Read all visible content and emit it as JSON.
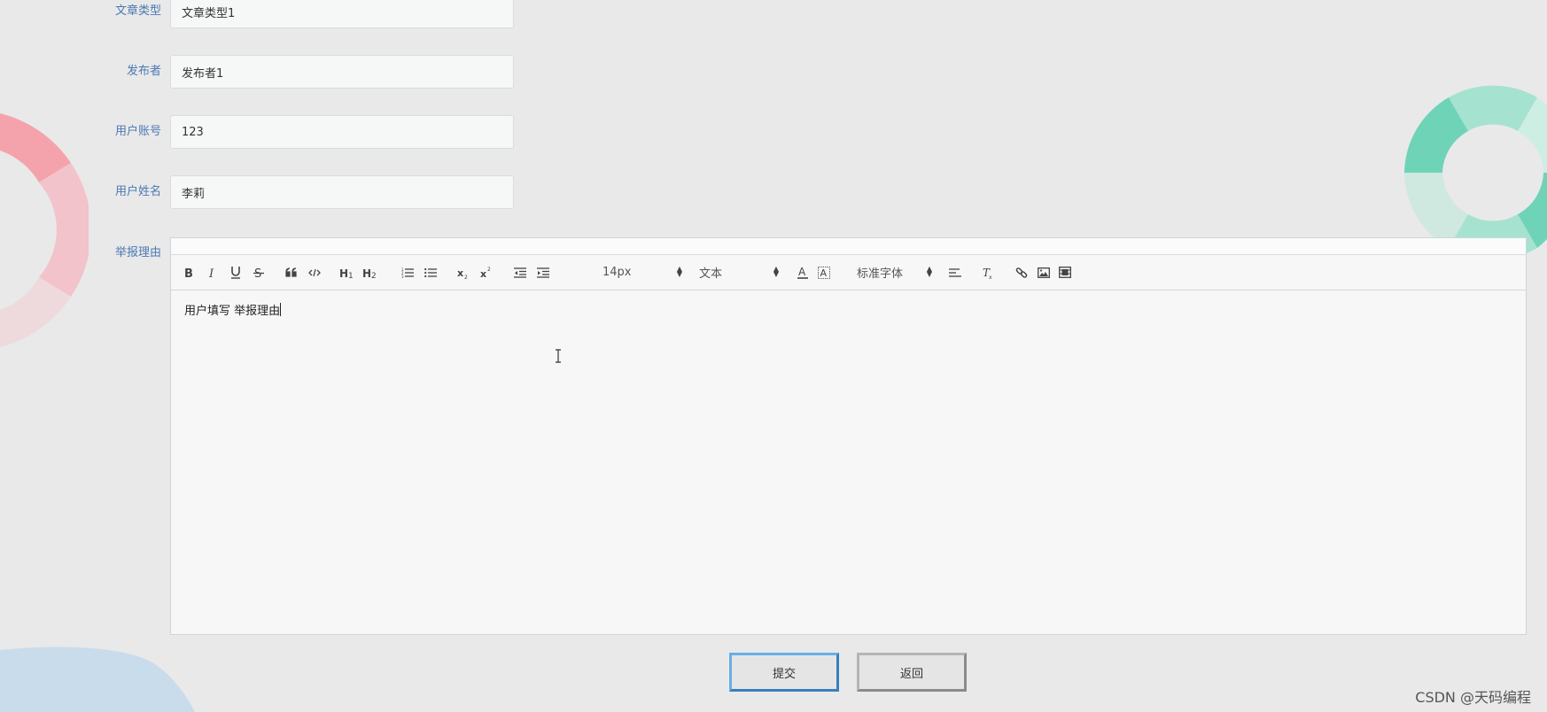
{
  "form": {
    "fields": [
      {
        "label": "文章类型",
        "value": "文章类型1"
      },
      {
        "label": "发布者",
        "value": "发布者1"
      },
      {
        "label": "用户账号",
        "value": "123"
      },
      {
        "label": "用户姓名",
        "value": "李莉"
      }
    ],
    "reason_label": "举报理由"
  },
  "editor": {
    "toolbar": {
      "font_size": "14px",
      "heading": "文本",
      "font_family": "标准字体",
      "icons": [
        "bold-icon",
        "italic-icon",
        "underline-icon",
        "strike-icon",
        "quote-icon",
        "code-icon",
        "h1-icon",
        "h2-icon",
        "ordered-list-icon",
        "bullet-list-icon",
        "subscript-icon",
        "superscript-icon",
        "outdent-icon",
        "indent-icon",
        "font-color-icon",
        "background-color-icon",
        "align-icon",
        "clear-format-icon",
        "link-icon",
        "image-icon",
        "video-icon"
      ]
    },
    "content": "用户填写 举报理由"
  },
  "buttons": {
    "submit": "提交",
    "back": "返回"
  },
  "watermark": "CSDN @天码编程",
  "colors": {
    "background": "#e9e9e9",
    "label": "#4b78b4",
    "submit_border": "#3a7ebd",
    "deco_pink": "#f4a3ad",
    "deco_teal": "#6fd3b8",
    "deco_blue": "#c9dcec"
  }
}
